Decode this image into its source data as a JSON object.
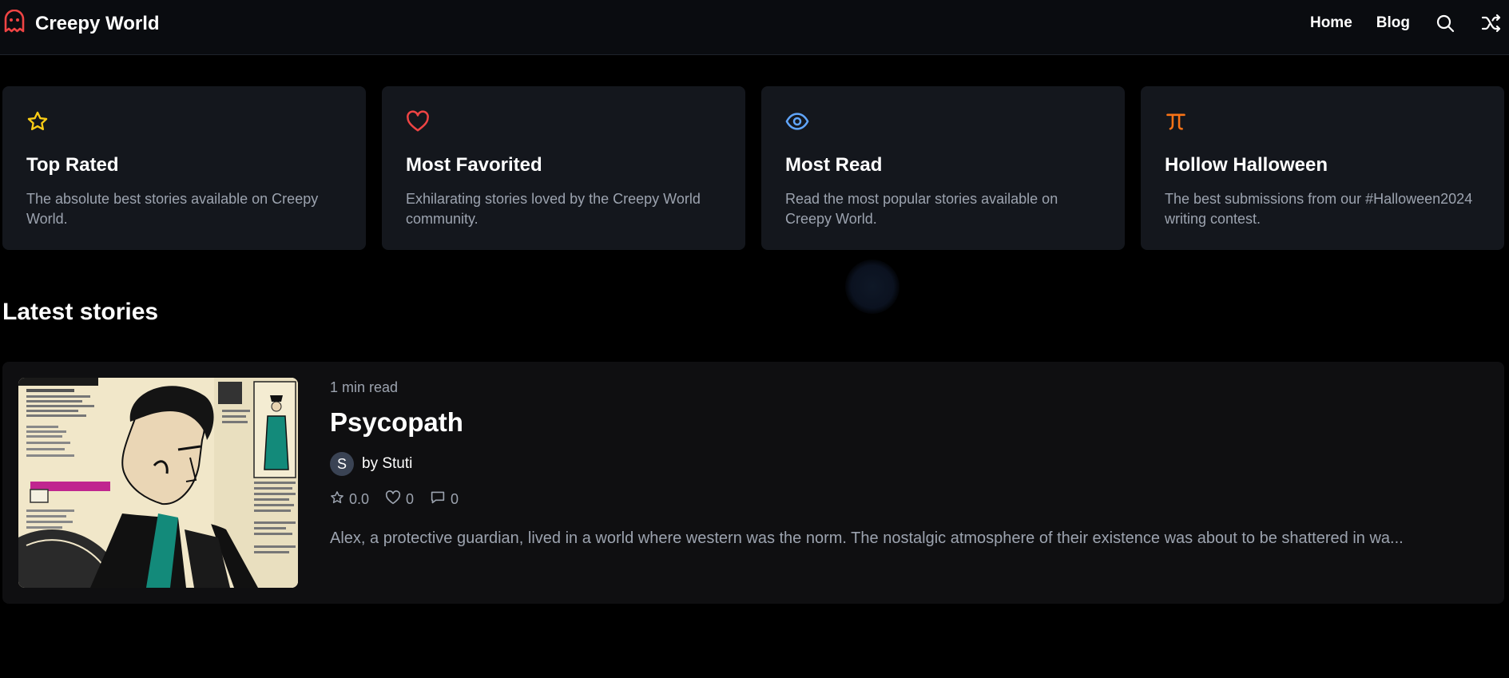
{
  "header": {
    "app_name": "Creepy World",
    "logo_icon": "ghost-icon",
    "nav": [
      {
        "label": "Home"
      },
      {
        "label": "Blog"
      }
    ],
    "search_icon": "search-icon",
    "random_icon": "shuffle-icon"
  },
  "cards": [
    {
      "icon": "star-icon",
      "color": "#facc15",
      "title": "Top Rated",
      "description": "The absolute best stories available on Creepy World."
    },
    {
      "icon": "heart-icon",
      "color": "#ef4444",
      "title": "Most Favorited",
      "description": "Exhilarating stories loved by the Creepy World community."
    },
    {
      "icon": "eye-icon",
      "color": "#60a5fa",
      "title": "Most Read",
      "description": "Read the most popular stories available on Creepy World."
    },
    {
      "icon": "pi-icon",
      "color": "#f97316",
      "title": "Hollow Halloween",
      "description": "The best submissions from our #Halloween2024 writing contest."
    }
  ],
  "latest": {
    "heading": "Latest stories",
    "stories": [
      {
        "read_time": "1 min read",
        "title": "Psycopath",
        "author_initial": "S",
        "author": "by Stuti",
        "rating": "0.0",
        "favorites": "0",
        "comments": "0",
        "excerpt": "Alex, a protective guardian, lived in a world where western was the norm. The nostalgic atmosphere of their existence was about to be shattered in wa..."
      }
    ]
  },
  "colors": {
    "background": "#000000",
    "card": "#14171d",
    "muted_text": "#9ca3af",
    "logo": "#ef4444"
  }
}
